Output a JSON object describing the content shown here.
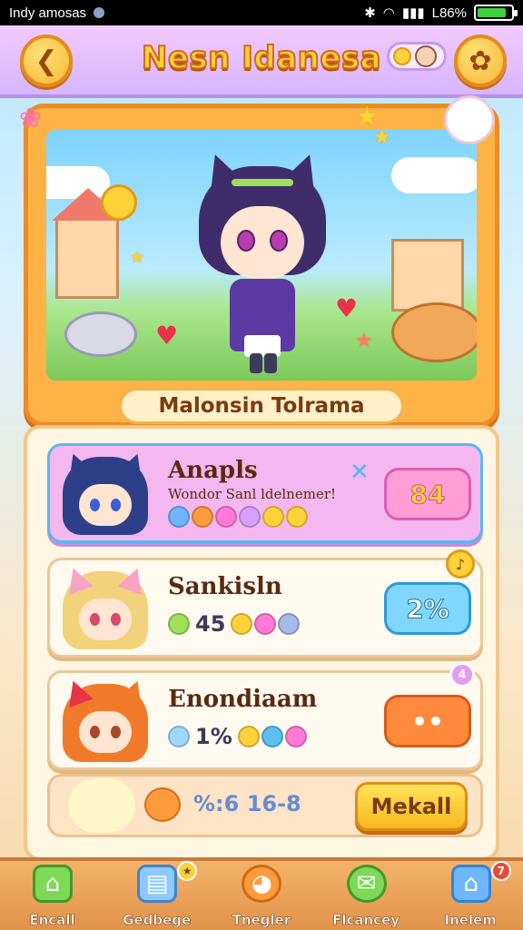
{
  "status_bar": {
    "carrier": "Indy amosas",
    "battery_text": "L86%",
    "battery_level": 0.86
  },
  "header": {
    "title": "Nesn Idanesa",
    "back_icon": "chevron-left-icon",
    "settings_icon": "gear-icon"
  },
  "hero": {
    "caption": "Malonsin Tolrama"
  },
  "cards": [
    {
      "name": "Anapls",
      "subtitle": "Wondor Sanl ldelnemer!",
      "stats": "",
      "badge": "84",
      "colors": {
        "hair": "#2e3f8a",
        "eye": "#3a5fd6"
      }
    },
    {
      "name": "Sankisln",
      "subtitle": "",
      "stats": "45",
      "badge": "2%",
      "colors": {
        "hair": "#f2d27a",
        "eye": "#d64a6a"
      }
    },
    {
      "name": "Enondiaam",
      "subtitle": "",
      "stats": "1%",
      "badge": "",
      "colors": {
        "hair": "#f07a2a",
        "eye": "#a84a2a"
      }
    }
  ],
  "strip": {
    "text": "%:6 16-8",
    "cta_label": "Mekall"
  },
  "nav": [
    {
      "label": "Encall",
      "icon": "home-icon"
    },
    {
      "label": "Gedbege",
      "icon": "map-icon"
    },
    {
      "label": "Tnegler",
      "icon": "pet-icon"
    },
    {
      "label": "Flcancey",
      "icon": "chat-icon"
    },
    {
      "label": "Inelem",
      "icon": "house-icon"
    }
  ]
}
